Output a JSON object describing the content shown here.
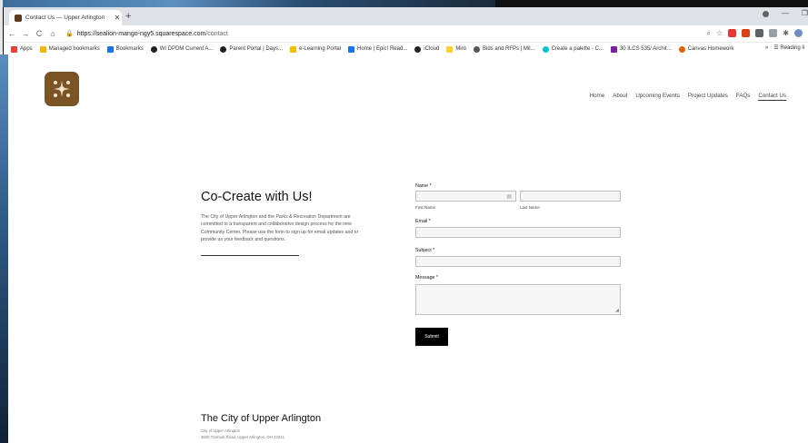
{
  "browser": {
    "tab_title": "Contact Us — Upper Arlington",
    "url_domain": "https://sealion-mango-ngy5.squarespace.com",
    "url_path": "/contact",
    "bookmarks": [
      {
        "label": "Apps",
        "color": "#e94235"
      },
      {
        "label": "Managed bookmarks",
        "color": "#f2b600"
      },
      {
        "label": "Bookmarks",
        "color": "#1a73e8"
      },
      {
        "label": "WI DPDM Current A...",
        "color": "#202124"
      },
      {
        "label": "Parent Portal | Days...",
        "color": "#202124"
      },
      {
        "label": "e-Learning Portal",
        "color": "#fbbc04"
      },
      {
        "label": "Home | Epic! Read...",
        "color": "#1a73e8"
      },
      {
        "label": "iCloud",
        "color": "#202124"
      },
      {
        "label": "Miro",
        "color": "#ffd02f"
      },
      {
        "label": "Bids and RFPs | Mil...",
        "color": "#555"
      },
      {
        "label": "Create a palette - C...",
        "color": "#00c4cc"
      },
      {
        "label": "30 ILCS 535/ Archit...",
        "color": "#7b1fa2"
      },
      {
        "label": "Canvas Homework",
        "color": "#e66000"
      }
    ],
    "bookmarks_overflow": "»",
    "reading_list": "Reading li"
  },
  "nav": {
    "items": [
      "Home",
      "About",
      "Upcoming Events",
      "Project Updates",
      "FAQs",
      "Contact Us"
    ]
  },
  "hero": {
    "title": "Co-Create with Us!",
    "text": "The City of Upper Arlington and the Parks & Recreation Department are committed to a transparent and collaborative design process for the new Community Center. Please use the form to sign up for email updates and to provide us your feedback and questions."
  },
  "form": {
    "name_label": "Name *",
    "first_name_label": "First Name",
    "last_name_label": "Last Name",
    "email_label": "Email *",
    "subject_label": "Subject *",
    "message_label": "Message *",
    "submit_label": "Submit"
  },
  "footer": {
    "title": "The City of Upper Arlington",
    "line1": "City of Upper Arlington",
    "line2": "3600 Tremont Road, Upper Arlington, OH 43221"
  }
}
